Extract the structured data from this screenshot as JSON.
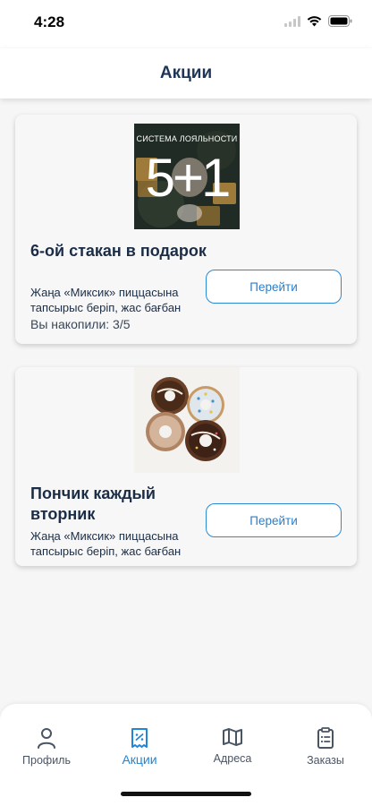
{
  "status_bar": {
    "time": "4:28"
  },
  "header": {
    "title": "Акции"
  },
  "promos": [
    {
      "image": {
        "top_text": "СИСТЕМА ЛОЯЛЬНОСТИ",
        "big_text": "5+1"
      },
      "title": "6-ой стакан в подарок",
      "subtitle": "Жаңа «Миксик» пиццасына тапсырыс беріп, жас бағбан",
      "progress": "Вы накопили: 3/5",
      "button_label": "Перейти"
    },
    {
      "title": "Пончик каждый вторник",
      "subtitle": "Жаңа «Миксик» пиццасына тапсырыс беріп, жас бағбан",
      "button_label": "Перейти"
    }
  ],
  "tab_bar": {
    "items": [
      {
        "label": "Профиль",
        "icon": "person-icon"
      },
      {
        "label": "Акции",
        "icon": "receipt-percent-icon",
        "active": true
      },
      {
        "label": "Адреса",
        "icon": "map-icon"
      },
      {
        "label": "Заказы",
        "icon": "clipboard-icon"
      }
    ]
  },
  "colors": {
    "accent": "#1f86d8",
    "title": "#1d3557",
    "background": "#f6f6f6"
  }
}
